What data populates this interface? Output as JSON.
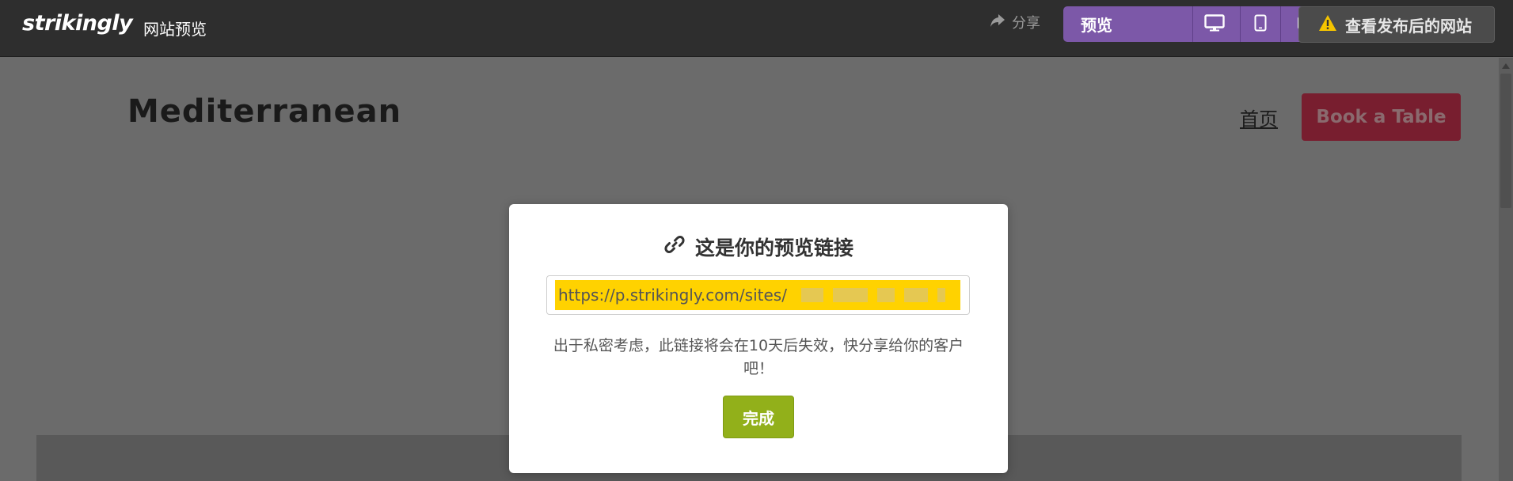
{
  "topbar": {
    "logo": "strikingly",
    "page_label": "网站预览",
    "share_label": "分享",
    "preview_label": "预览",
    "published_label": "查看发布后的网站",
    "device_icons": [
      "desktop-icon",
      "tablet-icon",
      "phone-icon"
    ],
    "colors": {
      "bar": "#2e2e2e",
      "preview": "#7c58a8",
      "published": "#4b4b4b",
      "warning": "#f5c400"
    }
  },
  "site": {
    "title": "Mediterranean",
    "nav_home": "首页",
    "book_button": "Book a Table",
    "colors": {
      "overlay": "#6b6b6b",
      "book_button": "#781e2f"
    }
  },
  "modal": {
    "title_icon": "link-icon",
    "title": "这是你的预览链接",
    "url": "https://p.strikingly.com/sites/",
    "note": "出于私密考虑，此链接将会在10天后失效，快分享给你的客户吧！",
    "done_label": "完成",
    "colors": {
      "url_highlight": "#ffd200",
      "done": "#92b01a"
    }
  }
}
